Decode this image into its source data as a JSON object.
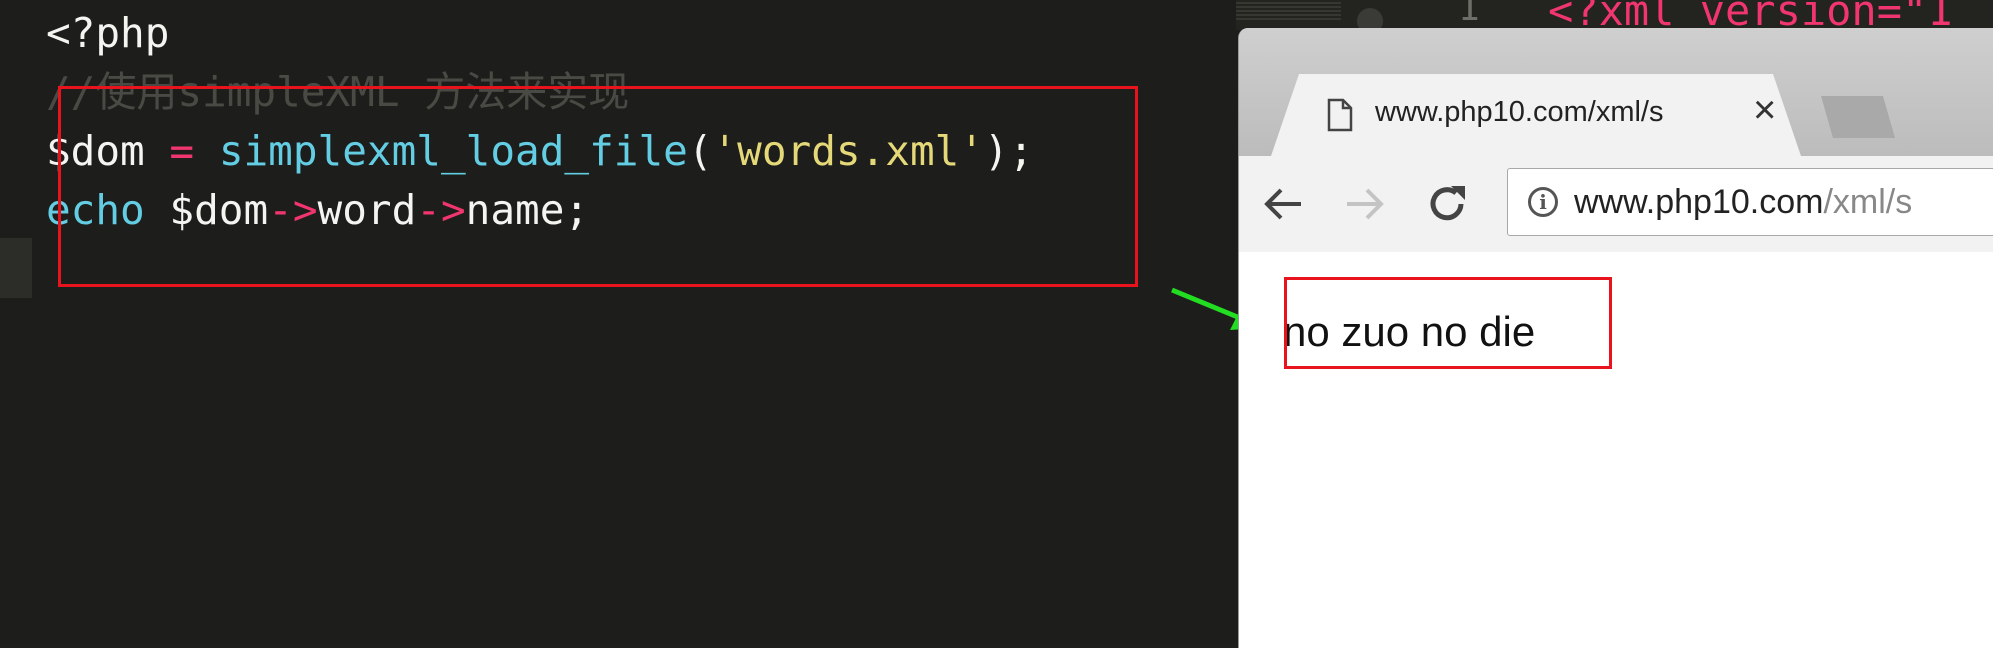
{
  "editor": {
    "lines": [
      {
        "tokens": [
          {
            "t": "<?php",
            "c": "c-punc"
          }
        ]
      },
      {
        "tokens": [
          {
            "t": "//使用simpleXML 方法来实现",
            "c": "c-comment"
          }
        ]
      },
      {
        "tokens": [
          {
            "t": "$dom",
            "c": "c-var"
          },
          {
            "t": " = ",
            "c": "c-op"
          },
          {
            "t": "simplexml_load_file",
            "c": "c-func"
          },
          {
            "t": "(",
            "c": "c-punc"
          },
          {
            "t": "'words.xml'",
            "c": "c-str"
          },
          {
            "t": ");",
            "c": "c-punc"
          }
        ]
      },
      {
        "tokens": [
          {
            "t": "echo",
            "c": "c-kw"
          },
          {
            "t": " $dom",
            "c": "c-var"
          },
          {
            "t": "->",
            "c": "c-op"
          },
          {
            "t": "word",
            "c": "c-var"
          },
          {
            "t": "->",
            "c": "c-op"
          },
          {
            "t": "name;",
            "c": "c-var"
          }
        ]
      }
    ]
  },
  "background_window": {
    "gutter_number": "1",
    "code_fragment": "<?xml version=\"1"
  },
  "browser": {
    "tab_title": "www.php10.com/xml/s",
    "url_host": "www.php10.com",
    "url_path": "/xml/s",
    "page_text": "no zuo no die"
  },
  "colors": {
    "highlight_box": "#e8131c",
    "arrow": "#22dd22",
    "keyword": "#63cde3",
    "operator": "#f1356f",
    "string": "#e4d879"
  },
  "icons": {
    "tab_icon": "page-icon",
    "close": "close-icon",
    "back": "back-arrow-icon",
    "forward": "forward-arrow-icon",
    "reload": "reload-icon",
    "info": "info-icon"
  }
}
